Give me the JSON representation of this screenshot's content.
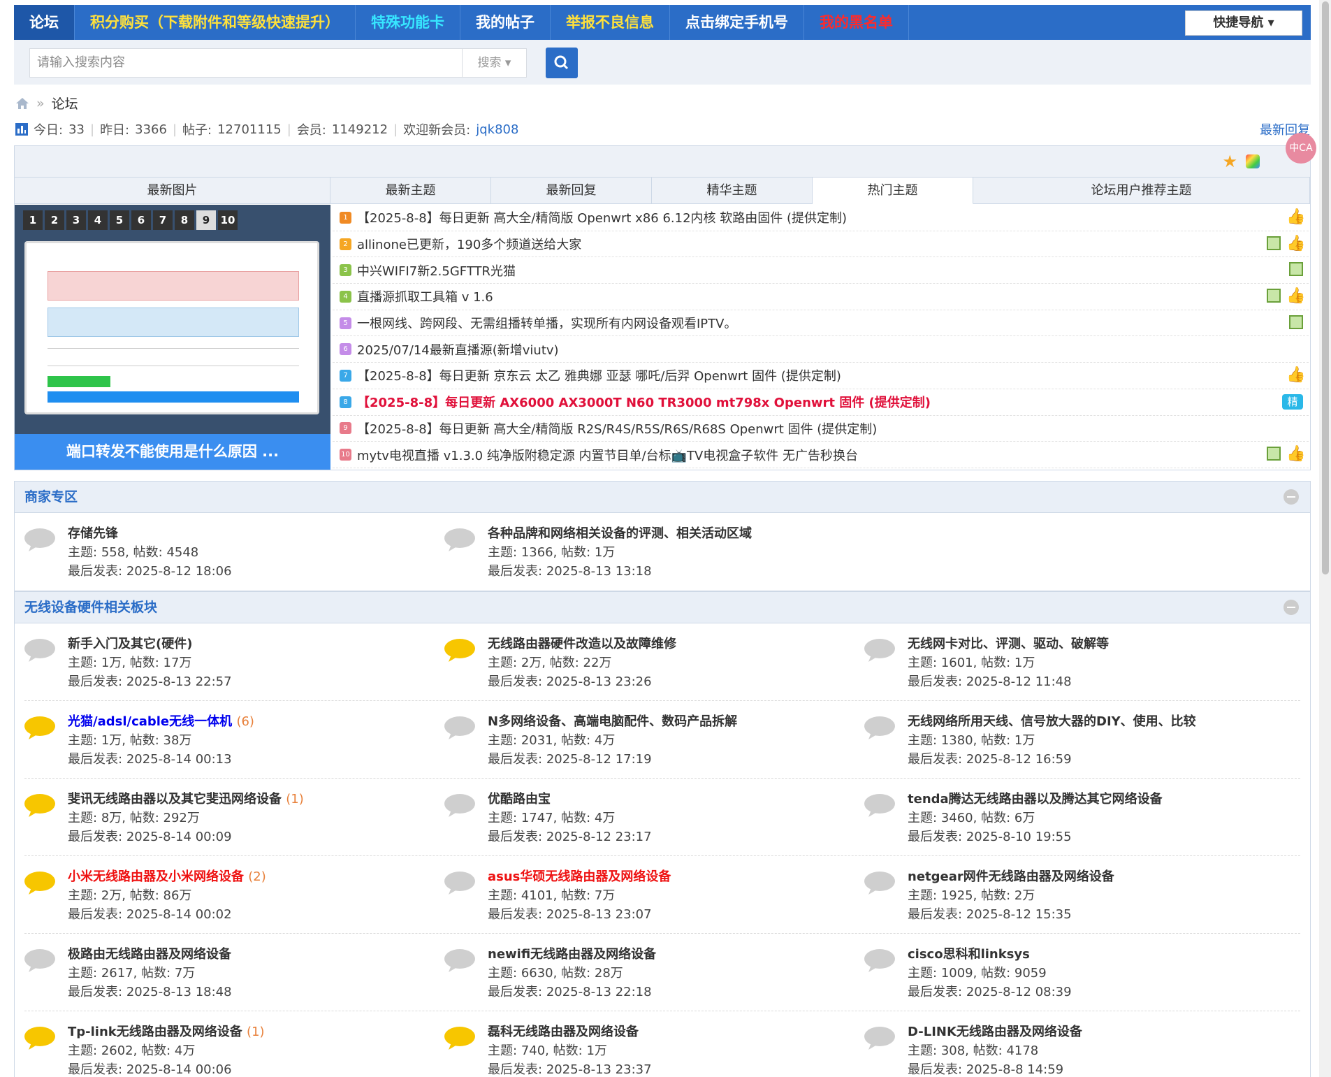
{
  "nav": {
    "home": "论坛",
    "items": [
      {
        "label": "积分购买（下载附件和等级快速提升）",
        "color": "#ffe13b"
      },
      {
        "label": "特殊功能卡",
        "color": "#37e6ff"
      },
      {
        "label": "我的帖子",
        "color": "#ffffff"
      },
      {
        "label": "举报不良信息",
        "color": "#ffe13b"
      },
      {
        "label": "点击绑定手机号",
        "color": "#ffffff"
      },
      {
        "label": "我的黑名单",
        "color": "#ff2a2a"
      }
    ],
    "quick_nav": "快捷导航"
  },
  "search": {
    "placeholder": "请输入搜索内容",
    "type_label": "搜索"
  },
  "breadcrumb": {
    "current": "论坛"
  },
  "stats": {
    "today_label": "今日:",
    "today": "33",
    "yesterday_label": "昨日:",
    "yesterday": "3366",
    "posts_label": "帖子:",
    "posts": "12701115",
    "members_label": "会员:",
    "members": "1149212",
    "welcome_label": "欢迎新会员:",
    "newest_member": "jqk808",
    "latest_reply": "最新回复"
  },
  "hot": {
    "tabs": [
      {
        "label": "最新图片"
      },
      {
        "label": "最新主题"
      },
      {
        "label": "最新回复"
      },
      {
        "label": "精华主题"
      },
      {
        "label": "热门主题"
      },
      {
        "label": "论坛用户推荐主题"
      }
    ],
    "active_tab": "热门主题",
    "slide_pages": [
      "1",
      "2",
      "3",
      "4",
      "5",
      "6",
      "7",
      "8",
      "9",
      "10"
    ],
    "slide_active": "9",
    "slide_caption": "端口转发不能使用是什么原因 ...",
    "threads": [
      {
        "num": "1",
        "color": "#f08a24",
        "title": "【2025-8-8】每日更新 高大全/精简版 Openwrt x86 6.12内核 软路由固件 (提供定制)",
        "img": false,
        "thumb": true,
        "jing": false,
        "red": false
      },
      {
        "num": "2",
        "color": "#f5a623",
        "title": "allinone已更新，190多个频道送给大家",
        "img": true,
        "thumb": true,
        "jing": false,
        "red": false
      },
      {
        "num": "3",
        "color": "#8bc34a",
        "title": "中兴WIFI7新2.5GFTTR光猫",
        "img": true,
        "thumb": false,
        "jing": false,
        "red": false
      },
      {
        "num": "4",
        "color": "#8bc34a",
        "title": "直播源抓取工具箱 v 1.6",
        "img": true,
        "thumb": true,
        "jing": false,
        "red": false
      },
      {
        "num": "5",
        "color": "#c48ce8",
        "title": "一根网线、跨网段、无需组播转单播，实现所有内网设备观看IPTV。",
        "img": true,
        "thumb": false,
        "jing": false,
        "red": false
      },
      {
        "num": "6",
        "color": "#c48ce8",
        "title": "2025/07/14最新直播源(新增viutv)",
        "img": false,
        "thumb": false,
        "jing": false,
        "red": false
      },
      {
        "num": "7",
        "color": "#3aa8e8",
        "title": "【2025-8-8】每日更新 京东云 太乙 雅典娜 亚瑟 哪吒/后羿 Openwrt 固件 (提供定制)",
        "img": false,
        "thumb": true,
        "jing": false,
        "red": false
      },
      {
        "num": "8",
        "color": "#3aa8e8",
        "title": "【2025-8-8】每日更新 AX6000 AX3000T N60 TR3000 mt798x Openwrt 固件 (提供定制)",
        "img": false,
        "thumb": false,
        "jing": true,
        "red": true
      },
      {
        "num": "9",
        "color": "#e87a8a",
        "title": "【2025-8-8】每日更新 高大全/精简版 R2S/R4S/R5S/R6S/R68S Openwrt 固件 (提供定制)",
        "img": false,
        "thumb": false,
        "jing": false,
        "red": false
      },
      {
        "num": "10",
        "color": "#e87a8a",
        "title": "mytv电视直播 v1.3.0 纯净版附稳定源 内置节目单/台标📺TV电视盒子软件 无广告秒换台",
        "img": true,
        "thumb": true,
        "jing": false,
        "red": false
      }
    ],
    "jing_label": "精"
  },
  "sections": [
    {
      "title": "商家专区",
      "forums": [
        {
          "name": "存储先锋",
          "new": "",
          "topics": "558",
          "posts": "4548",
          "last": "2025-8-12 18:06",
          "active": false,
          "style": ""
        },
        {
          "name": "各种品牌和网络相关设备的评测、相关活动区域",
          "new": "",
          "topics": "1366",
          "posts": "1万",
          "last": "2025-8-13 13:18",
          "active": false,
          "style": ""
        }
      ]
    },
    {
      "title": "无线设备硬件相关板块",
      "forums": [
        {
          "name": "新手入门及其它(硬件)",
          "new": "",
          "topics": "1万",
          "posts": "17万",
          "last": "2025-8-13 22:57",
          "active": false,
          "style": ""
        },
        {
          "name": "无线路由器硬件改造以及故障维修",
          "new": "",
          "topics": "2万",
          "posts": "22万",
          "last": "2025-8-13 23:26",
          "active": true,
          "style": ""
        },
        {
          "name": "无线网卡对比、评测、驱动、破解等",
          "new": "",
          "topics": "1601",
          "posts": "1万",
          "last": "2025-8-12 11:48",
          "active": false,
          "style": ""
        },
        {
          "name": "光猫/adsl/cable无线一体机",
          "new": "(6)",
          "topics": "1万",
          "posts": "38万",
          "last": "2025-8-14 00:13",
          "active": true,
          "style": "blue"
        },
        {
          "name": "N多网络设备、高端电脑配件、数码产品拆解",
          "new": "",
          "topics": "2031",
          "posts": "4万",
          "last": "2025-8-12 17:19",
          "active": false,
          "style": ""
        },
        {
          "name": "无线网络所用天线、信号放大器的DIY、使用、比较",
          "new": "",
          "topics": "1380",
          "posts": "1万",
          "last": "2025-8-12 16:59",
          "active": false,
          "style": ""
        },
        {
          "name": "斐讯无线路由器以及其它斐迅网络设备",
          "new": "(1)",
          "topics": "8万",
          "posts": "292万",
          "last": "2025-8-14 00:09",
          "active": true,
          "style": ""
        },
        {
          "name": "优酷路由宝",
          "new": "",
          "topics": "1747",
          "posts": "4万",
          "last": "2025-8-12 23:17",
          "active": false,
          "style": ""
        },
        {
          "name": "tenda腾达无线路由器以及腾达其它网络设备",
          "new": "",
          "topics": "3460",
          "posts": "6万",
          "last": "2025-8-10 19:55",
          "active": false,
          "style": ""
        },
        {
          "name": "小米无线路由器及小米网络设备",
          "new": "(2)",
          "topics": "2万",
          "posts": "86万",
          "last": "2025-8-14 00:02",
          "active": true,
          "style": "red"
        },
        {
          "name": "asus华硕无线路由器及网络设备",
          "new": "",
          "topics": "4101",
          "posts": "7万",
          "last": "2025-8-13 23:07",
          "active": false,
          "style": "red"
        },
        {
          "name": "netgear网件无线路由器及网络设备",
          "new": "",
          "topics": "1925",
          "posts": "2万",
          "last": "2025-8-12 15:35",
          "active": false,
          "style": ""
        },
        {
          "name": "极路由无线路由器及网络设备",
          "new": "",
          "topics": "2617",
          "posts": "7万",
          "last": "2025-8-13 18:48",
          "active": false,
          "style": ""
        },
        {
          "name": "newifi无线路由器及网络设备",
          "new": "",
          "topics": "6630",
          "posts": "28万",
          "last": "2025-8-13 22:18",
          "active": false,
          "style": ""
        },
        {
          "name": "cisco思科和linksys",
          "new": "",
          "topics": "1009",
          "posts": "9059",
          "last": "2025-8-12 08:39",
          "active": false,
          "style": ""
        },
        {
          "name": "Tp-link无线路由器及网络设备",
          "new": "(1)",
          "topics": "2602",
          "posts": "4万",
          "last": "2025-8-14 00:06",
          "active": true,
          "style": ""
        },
        {
          "name": "磊科无线路由器及网络设备",
          "new": "",
          "topics": "740",
          "posts": "1万",
          "last": "2025-8-13 23:37",
          "active": true,
          "style": ""
        },
        {
          "name": "D-LINK无线路由器及网络设备",
          "new": "",
          "topics": "308",
          "posts": "4178",
          "last": "2025-8-8 14:59",
          "active": false,
          "style": ""
        }
      ]
    }
  ],
  "labels": {
    "topics": "主题:",
    "posts": "帖数:",
    "last": "最后发表:"
  },
  "float_badge": "中CA"
}
